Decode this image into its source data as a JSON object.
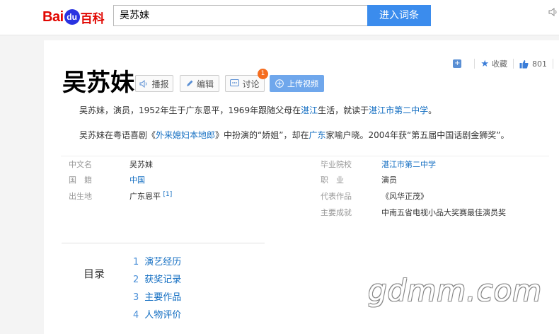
{
  "header": {
    "logo": {
      "bai": "Bai",
      "du": "du",
      "baike": "百科"
    },
    "search_value": "吴苏妹",
    "search_button": "进入词条"
  },
  "stats": {
    "collect": "收藏",
    "likes": "801"
  },
  "entry": {
    "title": "吴苏妹",
    "buttons": {
      "play": "播报",
      "edit": "编辑",
      "discuss": "讨论",
      "discuss_badge": "1",
      "upload": "上传视频"
    },
    "summary_1": {
      "p1": "吴苏妹，演员，1952年生于广东恩平，1969年跟随父母在",
      "link1": "湛江",
      "p2": "生活，就读于",
      "link2": "湛江市第二中学",
      "p3": "。"
    },
    "summary_2": {
      "p1": "吴苏妹在粤语喜剧《",
      "link1": "外来媳妇本地郎",
      "p2": "》中扮演的“娇姐”，却在",
      "link2": "广东",
      "p3": "家喻户晓。2004年获“第五届中国话剧金狮奖”。"
    },
    "basic_info": {
      "left": [
        {
          "label": "中文名",
          "value": "吴苏妹"
        },
        {
          "label": "国　籍",
          "value": "中国"
        },
        {
          "label": "出生地",
          "value": "广东恩平",
          "ref": "[1]"
        }
      ],
      "right": [
        {
          "label": "毕业院校",
          "value": "湛江市第二中学"
        },
        {
          "label": "职　业",
          "value": "演员"
        },
        {
          "label": "代表作品",
          "value": "《风华正茂》"
        },
        {
          "label": "主要成就",
          "value": "中南五省电视小品大奖赛最佳演员奖"
        }
      ]
    },
    "toc": {
      "title": "目录",
      "items": [
        {
          "num": "1",
          "text": "演艺经历"
        },
        {
          "num": "2",
          "text": "获奖记录"
        },
        {
          "num": "3",
          "text": "主要作品"
        },
        {
          "num": "4",
          "text": "人物评价"
        }
      ]
    }
  },
  "watermark": "gdmm.com",
  "colors": {
    "link": "#136ec2",
    "search_button": "#3b8ced",
    "logo_red": "#e10601",
    "logo_blue": "#2932e1",
    "badge": "#f56c1e"
  }
}
